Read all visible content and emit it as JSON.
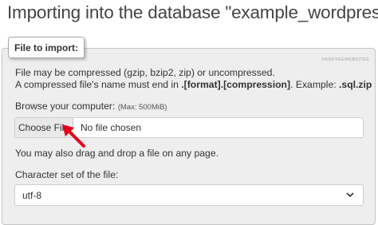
{
  "header": {
    "title": "Importing into the database \"example_wordpress\""
  },
  "file_section": {
    "legend": "File to import:",
    "compression_note": "File may be compressed (gzip, bzip2, zip) or uncompressed.",
    "name_note_prefix": "A compressed file's name must end in ",
    "name_note_format": ".[format].[compression]",
    "name_note_example_prefix": ". Example: ",
    "name_note_example": ".sql.zip",
    "browse_label": "Browse your computer: ",
    "browse_max": "(Max: 500MiB)",
    "choose_file_button": "Choose File",
    "no_file_text": "No file chosen",
    "drag_drop_note": "You may also drag and drop a file on any page.",
    "charset_label": "Character set of the file:",
    "charset_value": "utf-8"
  },
  "watermark": {
    "text": "HASHTAGWEBSITES"
  },
  "colors": {
    "arrow": "#e3001b",
    "panel_bg": "#eeeeee"
  },
  "icons": {
    "arrow": "red-arrow-icon",
    "dropdown": "chevron-down-icon"
  }
}
